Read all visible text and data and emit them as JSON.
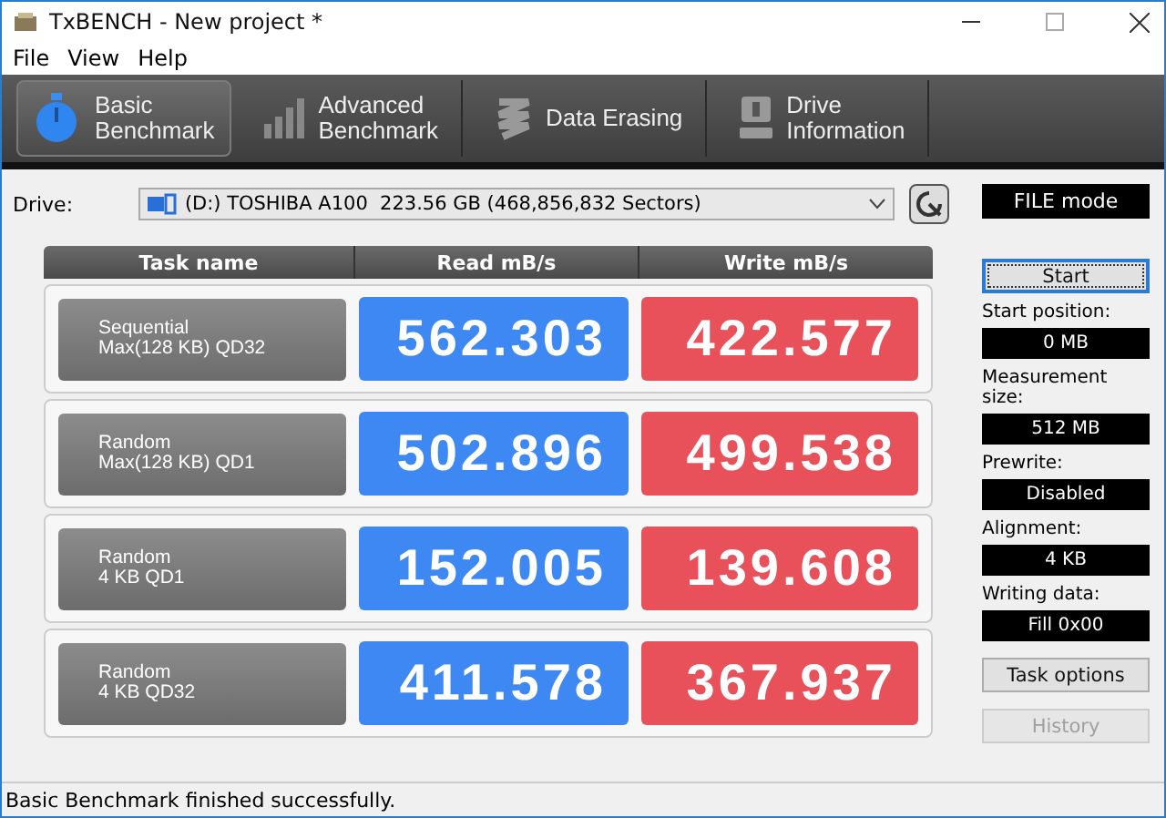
{
  "window": {
    "title": "TxBENCH - New project *"
  },
  "menu": [
    "File",
    "View",
    "Help"
  ],
  "tabs": [
    {
      "kind": "stopwatch",
      "lines": [
        "Basic",
        "Benchmark"
      ],
      "selected": true
    },
    {
      "kind": "bars",
      "lines": [
        "Advanced",
        "Benchmark"
      ],
      "selected": false
    },
    {
      "kind": "erase",
      "lines": [
        "Data Erasing"
      ],
      "selected": false
    },
    {
      "kind": "info",
      "lines": [
        "Drive",
        "Information"
      ],
      "selected": false
    }
  ],
  "drive": {
    "label": "Drive:",
    "value": "(D:) TOSHIBA A100  223.56 GB (468,856,832 Sectors)"
  },
  "mode": "FILE mode",
  "table": {
    "columns": [
      "Task name",
      "Read mB/s",
      "Write mB/s"
    ],
    "rows": [
      {
        "task": [
          "Sequential",
          "Max(128 KB) QD32"
        ],
        "read": "562.303",
        "write": "422.577"
      },
      {
        "task": [
          "Random",
          "Max(128 KB) QD1"
        ],
        "read": "502.896",
        "write": "499.538"
      },
      {
        "task": [
          "Random",
          "4 KB QD1"
        ],
        "read": "152.005",
        "write": "139.608"
      },
      {
        "task": [
          "Random",
          "4 KB QD32"
        ],
        "read": "411.578",
        "write": "367.937"
      }
    ]
  },
  "start_button": {
    "label": "Start",
    "focused": true
  },
  "settings": [
    {
      "label": "Start position:",
      "value": "0 MB"
    },
    {
      "label": "Measurement size:",
      "value": "512 MB"
    },
    {
      "label": "Prewrite:",
      "value": "Disabled"
    },
    {
      "label": "Alignment:",
      "value": "4 KB"
    },
    {
      "label": "Writing data:",
      "value": "Fill 0x00"
    }
  ],
  "buttons": [
    {
      "label": "Task options",
      "disabled": false
    },
    {
      "label": "History",
      "disabled": true
    }
  ],
  "status_bar": "Basic Benchmark finished successfully."
}
